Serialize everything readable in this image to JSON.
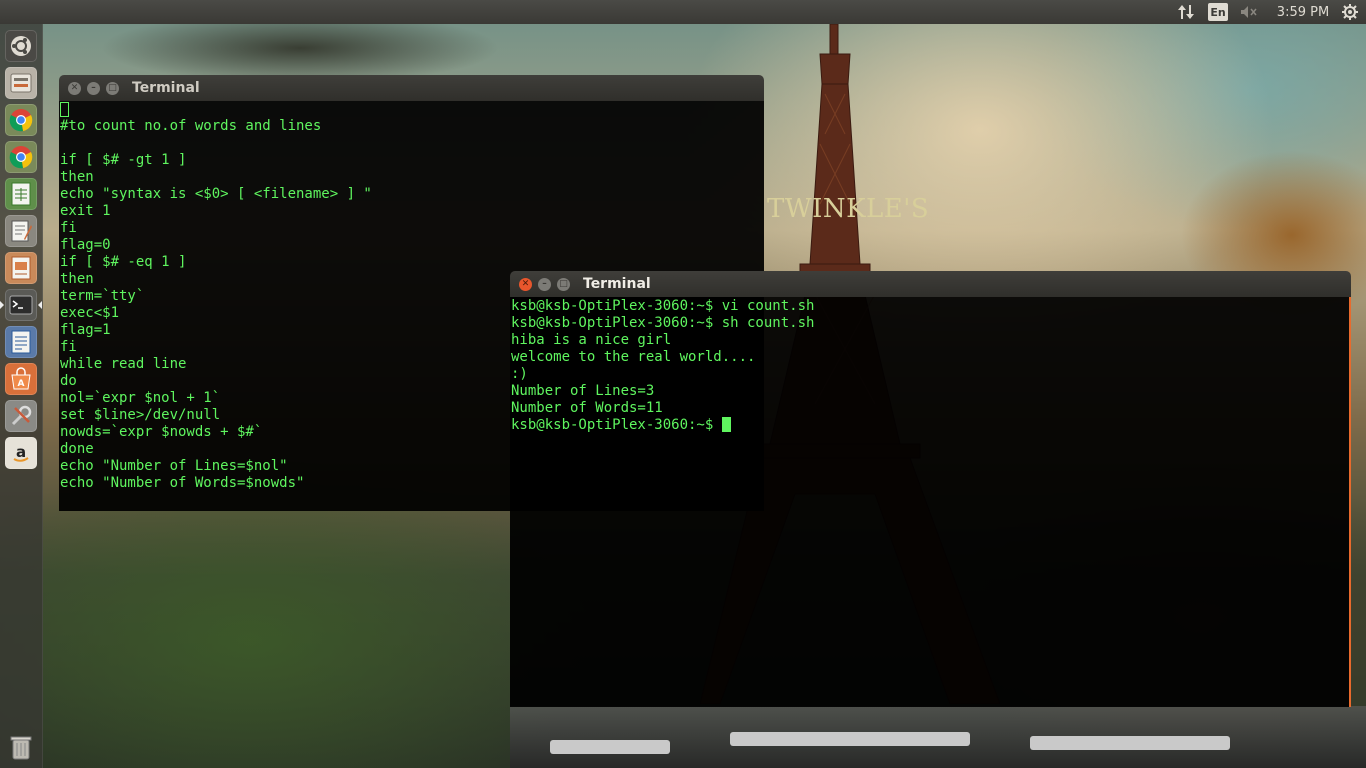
{
  "top_panel": {
    "keyboard_layout": "En",
    "clock": "3:59 PM",
    "icons": [
      "network-icon",
      "volume-muted-icon",
      "settings-gear-icon"
    ]
  },
  "wallpaper": {
    "watermark_text": "TWINKLE'S"
  },
  "launcher": {
    "items": [
      {
        "name": "dash-home",
        "icon": "ubuntu-logo-icon"
      },
      {
        "name": "files",
        "icon": "file-manager-icon"
      },
      {
        "name": "chrome-1",
        "icon": "chrome-icon"
      },
      {
        "name": "chrome-2",
        "icon": "chrome-icon"
      },
      {
        "name": "calc",
        "icon": "spreadsheet-icon"
      },
      {
        "name": "text-editor",
        "icon": "text-editor-icon"
      },
      {
        "name": "impress",
        "icon": "presentation-icon"
      },
      {
        "name": "terminal",
        "icon": "terminal-icon",
        "active": true
      },
      {
        "name": "writer",
        "icon": "document-icon"
      },
      {
        "name": "software-center",
        "icon": "software-center-icon"
      },
      {
        "name": "system-settings",
        "icon": "settings-tools-icon"
      },
      {
        "name": "amazon",
        "icon": "amazon-icon"
      }
    ],
    "trash_icon": "trash-icon"
  },
  "editor_window": {
    "title": "Terminal",
    "lines": [
      "",
      "#to count no.of words and lines",
      "",
      "if [ $# -gt 1 ]",
      "then",
      "echo \"syntax is <$0> [ <filename> ] \"",
      "exit 1",
      "fi",
      "flag=0",
      "if [ $# -eq 1 ]",
      "then",
      "term=`tty`",
      "exec<$1",
      "flag=1",
      "fi",
      "while read line",
      "do",
      "nol=`expr $nol + 1`",
      "set $line>/dev/null",
      "nowds=`expr $nowds + $#`",
      "done",
      "echo \"Number of Lines=$nol\"",
      "echo \"Number of Words=$nowds\""
    ]
  },
  "shell_window": {
    "title": "Terminal",
    "lines": [
      "ksb@ksb-OptiPlex-3060:~$ vi count.sh",
      "ksb@ksb-OptiPlex-3060:~$ sh count.sh",
      "hiba is a nice girl",
      "welcome to the real world....",
      ":)",
      "Number of Lines=3",
      "Number of Words=11"
    ],
    "prompt": "ksb@ksb-OptiPlex-3060:~$ "
  },
  "colors": {
    "terminal_text": "#5ff55f",
    "close_button_active": "#e8562c",
    "panel_bg": "#3c3b37"
  }
}
